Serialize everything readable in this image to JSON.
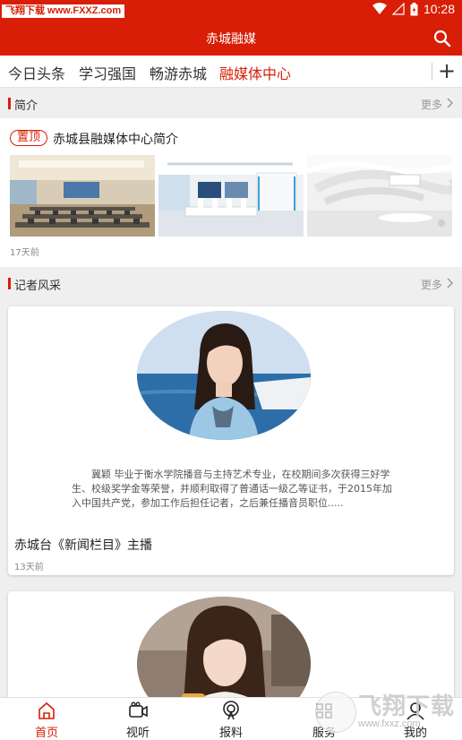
{
  "status_bar": {
    "watermark": "飞翔下载 www.FXXZ.com",
    "time": "10:28",
    "background": "#d81e06"
  },
  "header": {
    "title": "赤城融媒",
    "search_icon": "search-icon"
  },
  "tabs": [
    {
      "label": "今日头条",
      "active": false
    },
    {
      "label": "学习强国",
      "active": false
    },
    {
      "label": "畅游赤城",
      "active": false
    },
    {
      "label": "融媒体中心",
      "active": true
    }
  ],
  "add_tab_label": "+",
  "intro_section": {
    "title": "简介",
    "more": "更多",
    "item": {
      "tag": "置顶",
      "title": "赤城县融媒体中心简介",
      "time": "17天前"
    }
  },
  "reporter_section": {
    "title": "记者风采",
    "more": "更多",
    "cards": [
      {
        "caption": "冀颖 毕业于衡水学院播音与主持艺术专业，在校期间多次获得三好学生、校级奖学金等荣誉，并顺利取得了普通话一级乙等证书，于2015年加入中国共产党，参加工作后担任记者，之后兼任播音员职位.....",
        "title": "赤城台《新闻栏目》主播",
        "time": "13天前"
      },
      {
        "caption": "",
        "title": "",
        "time": ""
      }
    ]
  },
  "bottom_nav": [
    {
      "label": "首页",
      "icon": "home-icon",
      "active": true
    },
    {
      "label": "视听",
      "icon": "video-icon",
      "active": false
    },
    {
      "label": "报料",
      "icon": "broadcast-icon",
      "active": false
    },
    {
      "label": "服务",
      "icon": "service-icon",
      "active": false
    },
    {
      "label": "我的",
      "icon": "profile-icon",
      "active": false
    }
  ],
  "watermark_bottom": {
    "brand": "飞翔下载",
    "url": "www.fxxz.com"
  },
  "colors": {
    "accent": "#d81e06",
    "background": "#efefef"
  }
}
